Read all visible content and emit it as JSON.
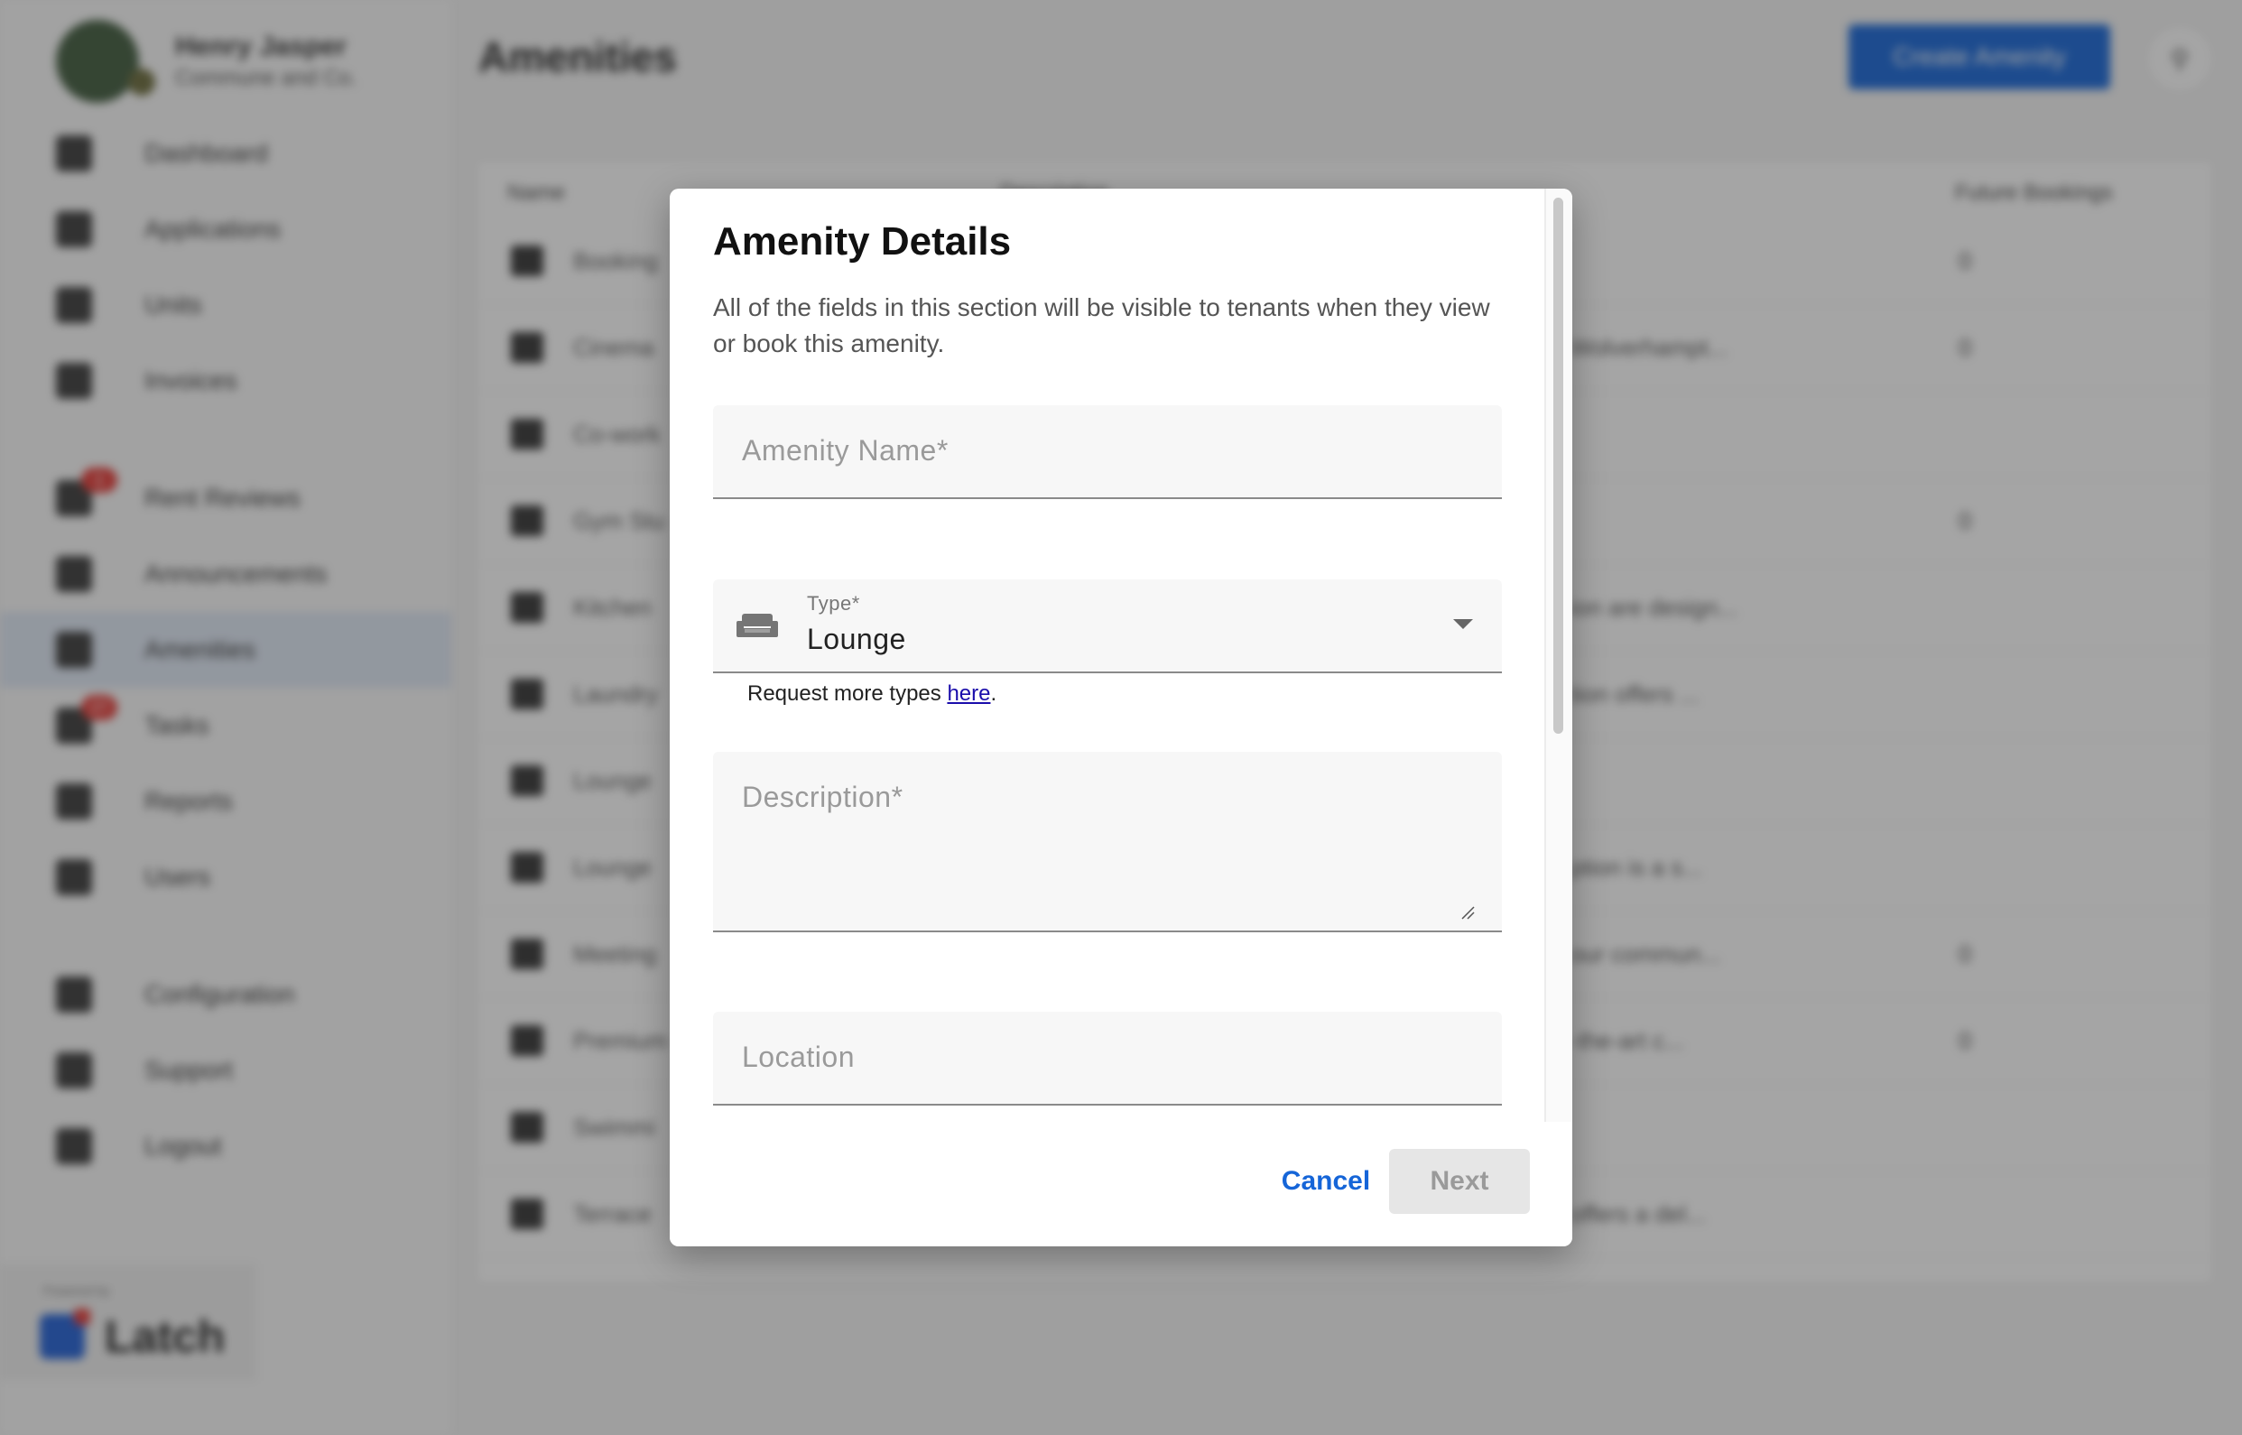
{
  "user": {
    "name": "Henry Jasper",
    "company": "Commune and Co."
  },
  "sidebar": {
    "items": [
      {
        "label": "Dashboard",
        "icon": "dashboard-icon"
      },
      {
        "label": "Applications",
        "icon": "applications-icon"
      },
      {
        "label": "Units",
        "icon": "units-icon"
      },
      {
        "label": "Invoices",
        "icon": "dollar-icon"
      },
      {
        "label": "Rent Reviews",
        "icon": "rent-reviews-icon",
        "badge": "1"
      },
      {
        "label": "Announcements",
        "icon": "announcements-icon"
      },
      {
        "label": "Amenities",
        "icon": "amenities-icon",
        "active": true
      },
      {
        "label": "Tasks",
        "icon": "tasks-icon",
        "badge": "27"
      },
      {
        "label": "Reports",
        "icon": "reports-icon"
      },
      {
        "label": "Users",
        "icon": "users-icon"
      },
      {
        "label": "Configuration",
        "icon": "gear-icon"
      },
      {
        "label": "Support",
        "icon": "support-icon"
      },
      {
        "label": "Logout",
        "icon": "logout-icon"
      }
    ]
  },
  "brand": {
    "powered_by": "Powered by",
    "name": "Latch"
  },
  "header": {
    "title": "Amenities",
    "create_label": "Create Amenity"
  },
  "table": {
    "columns": [
      "Name",
      "Description",
      "Future Bookings"
    ],
    "rows": [
      {
        "name": "Booking",
        "desc": "",
        "bookings": "0"
      },
      {
        "name": "Cinema",
        "desc": "Wolverhampt...",
        "bookings": "0"
      },
      {
        "name": "Co-work",
        "desc": "",
        "bookings": ""
      },
      {
        "name": "Gym Stu",
        "desc": "",
        "bookings": "0"
      },
      {
        "name": "Kitchen",
        "desc": "ion are design...",
        "bookings": ""
      },
      {
        "name": "Laundry",
        "desc": "tion offers ...",
        "bookings": ""
      },
      {
        "name": "Lounge",
        "desc": "",
        "bookings": ""
      },
      {
        "name": "Lounge",
        "desc": "ption is a s...",
        "bookings": ""
      },
      {
        "name": "Meeting",
        "desc": "our commun...",
        "bookings": "0"
      },
      {
        "name": "Premium",
        "desc": "-the-art c...",
        "bookings": "0"
      },
      {
        "name": "Swimmi",
        "desc": "",
        "bookings": ""
      },
      {
        "name": "Terrace",
        "desc": "offers a del...",
        "bookings": ""
      }
    ]
  },
  "dialog": {
    "title": "Amenity Details",
    "description": "All of the fields in this section will be visible to tenants when they view or book this amenity.",
    "name_label": "Amenity Name*",
    "type_label": "Type*",
    "type_value": "Lounge",
    "type_icon": "sofa-icon",
    "helper_prefix": "Request more types ",
    "helper_link": "here",
    "helper_suffix": ".",
    "description_label": "Description*",
    "location_label": "Location",
    "cancel_label": "Cancel",
    "next_label": "Next"
  },
  "colors": {
    "primary": "#1565d8",
    "badge": "#e53935",
    "disabled_bg": "#e6e6e6"
  }
}
